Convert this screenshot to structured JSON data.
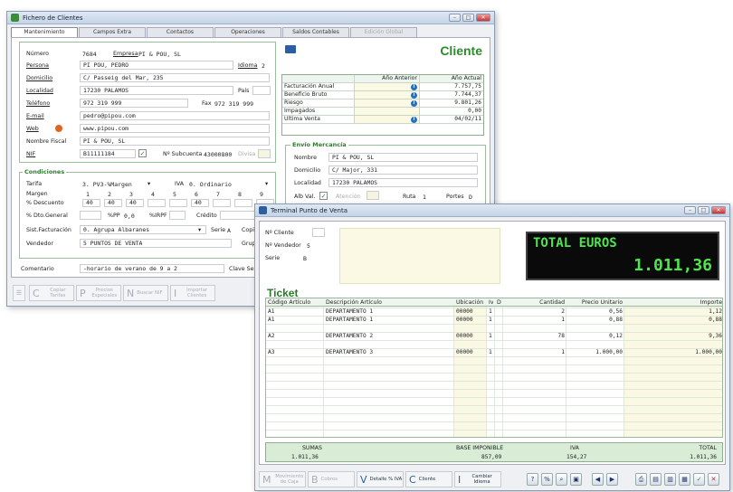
{
  "client_window": {
    "title": "Fichero de Clientes",
    "tabs": [
      "Mantenimiento",
      "Campos Extra",
      "Contactos",
      "Operaciones",
      "Saldos Contables",
      "Edición Global"
    ],
    "heading": "Cliente",
    "numero_label": "Número",
    "numero": "7684",
    "empresa_label": "Empresa",
    "empresa": "PI & POU, SL",
    "persona_label": "Persona",
    "persona": "PI POU, PEDRO",
    "idioma_label": "Idioma",
    "idioma": "2",
    "domicilio_label": "Domicilio",
    "domicilio": "C/ Passeig del Mar, 235",
    "localidad_label": "Localidad",
    "localidad": "17230 PALAMOS",
    "pais_label": "País",
    "telefono_label": "Teléfono",
    "telefono": "972 319 999",
    "fax_label": "Fax",
    "fax": "972 319 999",
    "email_label": "E-mail",
    "email": "pedro@pipou.com",
    "web_label": "Web",
    "web": "www.pipou.com",
    "nombre_fiscal_label": "Nombre Fiscal",
    "nombre_fiscal": "PI & POU, SL",
    "nif_label": "NIF",
    "nif": "B11111184",
    "subcuenta_label": "Nº Subcuenta",
    "subcuenta": "43000800",
    "divisa_label": "Divisa",
    "summary_headers": [
      "Año Anterior",
      "Año Actual"
    ],
    "summary_rows": [
      {
        "label": "Facturación Anual",
        "value": "7.757,75",
        "info": true
      },
      {
        "label": "Beneficio Bruto",
        "value": "7.744,37",
        "info": true
      },
      {
        "label": "Riesgo",
        "value": "9.801,26",
        "info": true
      },
      {
        "label": "Impagados",
        "value": "0,00",
        "info": false
      },
      {
        "label": "Última Venta",
        "value": "04/02/11",
        "info": true
      }
    ],
    "envio_title": "Envío Mercancía",
    "envio_nombre_label": "Nombre",
    "envio_nombre": "PI & POU, SL",
    "envio_domicilio_label": "Domicilio",
    "envio_domicilio": "C/ Major, 331",
    "envio_localidad_label": "Localidad",
    "envio_localidad": "17230 PALAMOS",
    "alb_val_label": "Alb Val.",
    "atencion_label": "Atención",
    "ruta_label": "Ruta",
    "ruta": "1",
    "portes_label": "Portes",
    "portes": "D",
    "condiciones_title": "Condiciones",
    "tarifa_label": "Tarifa",
    "tarifa": "3. PV3-%Margen",
    "iva_label": "IVA",
    "iva": "0. Ordinario",
    "margen_label": "Margen",
    "margen_cols": [
      "1",
      "2",
      "3",
      "4",
      "5",
      "6",
      "7",
      "8",
      "9"
    ],
    "descuento_label": "% Descuento",
    "descuento_vals": [
      "40",
      "40",
      "40",
      "",
      "",
      "40",
      "",
      "",
      ""
    ],
    "dto_general_label": "% Dto.General",
    "pct_pp_label": "%PP",
    "pct_pp": "0,0",
    "pct_irpf_label": "%IRPF",
    "credito_label": "Crédito",
    "sist_fact_label": "Sist.Facturación",
    "sist_fact": "0. Agrupa Albaranes",
    "serie_label": "Serie",
    "serie": "A",
    "copia_label": "Copia",
    "vendedor_label": "Vendedor",
    "vendedor": "5 PUNTOS DE VENTA",
    "grupo_label": "Grupo",
    "comentario_label": "Comentario",
    "comentario": "-horario de verano de 9 a 2",
    "clave_label": "Clave Selección",
    "bottom_buttons": [
      {
        "key": "C",
        "label": "Copiar Tarifas"
      },
      {
        "key": "P",
        "label": "Precios Especiales"
      },
      {
        "key": "N",
        "label": "Buscar NIF"
      },
      {
        "key": "I",
        "label": "Importar Clientes"
      }
    ]
  },
  "pos_window": {
    "title": "Terminal Punto de Venta",
    "cliente_label": "Nº Cliente",
    "vendedor_label": "Nº Vendedor",
    "vendedor": "5",
    "serie_label": "Serie",
    "serie": "B",
    "total_label": "TOTAL EUROS",
    "total": "1.011,36",
    "ticket_title": "Ticket",
    "columns": [
      "Código Artículo",
      "Descripción Artículo",
      "Ubicación",
      "Iva",
      "Dto",
      "Cantidad",
      "Precio Unitario",
      "Importe"
    ],
    "rows": [
      [
        "A1",
        "DEPARTAMENTO 1",
        "00000",
        "1",
        "",
        "2",
        "0,56",
        "1,12"
      ],
      [
        "A1",
        "DEPARTAMENTO 1",
        "00000",
        "1",
        "",
        "1",
        "0,88",
        "0,88"
      ],
      [
        "",
        "",
        "",
        "",
        "",
        "",
        "",
        ""
      ],
      [
        "A2",
        "DEPARTAMENTO 2",
        "00000",
        "1",
        "",
        "78",
        "0,12",
        "9,36"
      ],
      [
        "",
        "",
        "",
        "",
        "",
        "",
        "",
        ""
      ],
      [
        "A3",
        "DEPARTAMENTO 3",
        "00000",
        "1",
        "",
        "1",
        "1.000,00",
        "1.000,00"
      ]
    ],
    "sumas_label": "SUMAS",
    "sumas": "1.011,36",
    "base_label": "BASE IMPONIBLE",
    "base": "857,09",
    "iva_label": "IVA",
    "iva": "154,27",
    "total_footer_label": "TOTAL",
    "total_footer": "1.011,36",
    "bottom_buttons": [
      {
        "key": "M",
        "label": "Movimiento de Caja"
      },
      {
        "key": "B",
        "label": "Cobros"
      },
      {
        "key": "V",
        "label": "Detalle % IVA"
      },
      {
        "key": "C",
        "label": "Cliente"
      },
      {
        "key": "I",
        "label": "Cambiar Idioma"
      }
    ]
  }
}
